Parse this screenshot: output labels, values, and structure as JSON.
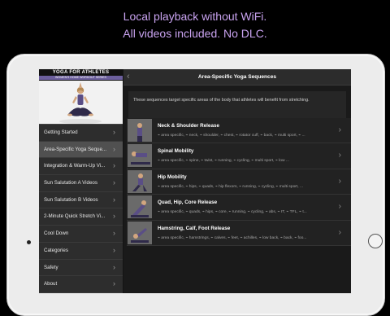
{
  "promo": {
    "line1": "Local playback without WiFi.",
    "line2": "All videos included. No DLC."
  },
  "app": {
    "logo_title": "YOGA FOR ATHLETES",
    "logo_subtitle": "WOMEN'S HOME WORKOUT SERIES"
  },
  "sidebar": {
    "items": [
      {
        "label": "Getting Started"
      },
      {
        "label": "Area-Specific Yoga Seque..."
      },
      {
        "label": "Integration & Warm-Up Vi..."
      },
      {
        "label": "Sun Salutation A Videos"
      },
      {
        "label": "Sun Salutation B Videos"
      },
      {
        "label": "2-Minute Quick Stretch Vi..."
      },
      {
        "label": "Cool Down"
      },
      {
        "label": "Categories"
      },
      {
        "label": "Safety"
      },
      {
        "label": "About"
      }
    ]
  },
  "main": {
    "title": "Area-Specific Yoga Sequences",
    "intro": "These sequences target specific areas of the body that athletes will benefit from stretching.",
    "sequences": [
      {
        "title": "Neck & Shoulder Release",
        "tags": "⌁ area specific, ⌁ neck, ⌁ shoulder, ⌁ chest, ⌁ rotator cuff, ⌁ back, ⌁ multi sport, ⌁ ..."
      },
      {
        "title": "Spinal Mobility",
        "tags": "⌁ area specific, ⌁ spine, ⌁ twist, ⌁ running, ⌁ cycling, ⌁ multi sport, ⌁ low ..."
      },
      {
        "title": "Hip Mobility",
        "tags": "⌁ area specific, ⌁ hips, ⌁ quads, ⌁ hip flexors, ⌁ running, ⌁ cycling, ⌁ multi sport, ..."
      },
      {
        "title": "Quad, Hip, Core Release",
        "tags": "⌁ area specific, ⌁ quads, ⌁ hips, ⌁ core, ⌁ running, ⌁ cycling, ⌁ abs, ⌁ IT, ⌁ TFL, ⌁ t..."
      },
      {
        "title": "Hamstring, Calf, Foot Release",
        "tags": "⌁ area specific, ⌁ hamstrings, ⌁ calves, ⌁ feet, ⌁ achilles, ⌁ low back, ⌁ back, ⌁ foo..."
      }
    ]
  },
  "icons": {
    "chevron": "chevron-right-icon",
    "back": "chevron-left-icon"
  },
  "colors": {
    "promo_text": "#c9a3f0",
    "banner_purple": "#6c5f9d"
  }
}
